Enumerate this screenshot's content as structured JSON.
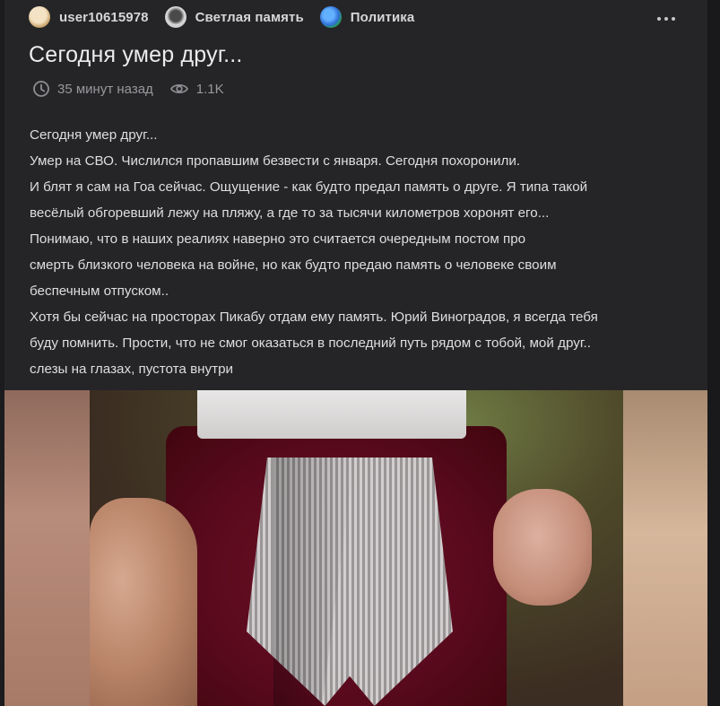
{
  "author_row": {
    "chips": [
      {
        "label": "user10615978",
        "icon": "user-avatar"
      },
      {
        "label": "Светлая память",
        "icon": "community-avatar"
      },
      {
        "label": "Политика",
        "icon": "community-avatar"
      }
    ]
  },
  "post": {
    "title": "Сегодня умер друг...",
    "meta": {
      "time": "35 минут назад",
      "time_icon": "clock-icon",
      "views": "1.1K",
      "views_icon": "eye-icon"
    },
    "body_lines": [
      "Сегодня умер друг...",
      "Умер на СВО. Числился пропавшим безвести с января. Сегодня похоронили.",
      "И блят я сам на Гоа сейчас. Ощущение - как будто предал память о друге. Я типа такой",
      "весёлый обгоревший лежу на пляжу, а где то за тысячи километров хоронят его...",
      "Понимаю, что в наших реалиях наверно это считается очередным постом про",
      "смерть близкого человека на войне, но как будто предаю память о человеке своим",
      "беспечным отпуском..",
      "Хотя бы сейчас на просторах Пикабу отдам ему память. Юрий Виноградов, я всегда тебя",
      "буду помнить. Прости, что не смог оказаться в последний путь рядом с тобой, мой друг..",
      "слезы на глазах, пустота внутри"
    ]
  },
  "colors": {
    "background": "#1c1c1e",
    "card": "#252528",
    "text_primary": "#ececee",
    "text_secondary": "#98989c"
  }
}
